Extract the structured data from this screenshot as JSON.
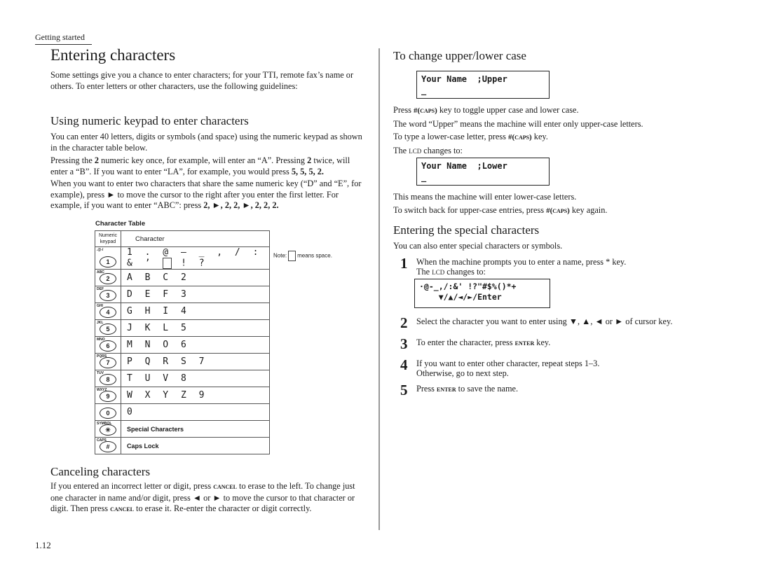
{
  "running_head": "Getting started",
  "page_title": "Entering characters",
  "intro": "Some settings give you a chance to enter characters; for your TTI, remote fax’s name or others. To enter letters or other characters, use the following guidelines:",
  "keypad_section": {
    "heading": "Using numeric keypad to enter characters",
    "p1": "You can enter 40 letters, digits or symbols (and space) using the numeric keypad as shown in the character table below.",
    "p2_a": "Pressing the ",
    "p2_b": "2",
    "p2_c": " numeric key once, for example, will enter an “A”. Pressing ",
    "p2_d": "2",
    "p2_e": " twice, will enter a “B”. If you want to enter “LA”, for example, you would press ",
    "p2_f": "5, 5, 5, 2.",
    "p3_a": "When you want to enter two characters that share the same numeric key (“D” and “E”, for example), press ► to move the cursor to the right after you enter the first letter. For example, if you want to enter “ABC”: press ",
    "p3_b": "2, ►, 2, 2, ►, 2, 2, 2."
  },
  "character_table": {
    "title": "Character Table",
    "header_key": "Numeric keypad",
    "header_chars": "Character",
    "note_prefix": "Note:",
    "note_suffix": "means space.",
    "rows": [
      {
        "key": "1",
        "sub": ".@-/",
        "chars_a": "1 . @ — _ , / : & ’",
        "chars_b": "! ?"
      },
      {
        "key": "2",
        "sub": "ABC",
        "chars": "A B C 2"
      },
      {
        "key": "3",
        "sub": "DEF",
        "chars": "D E F 3"
      },
      {
        "key": "4",
        "sub": "GHI",
        "chars": "G H I 4"
      },
      {
        "key": "5",
        "sub": "JKL",
        "chars": "J K L 5"
      },
      {
        "key": "6",
        "sub": "MNO",
        "chars": "M N O 6"
      },
      {
        "key": "7",
        "sub": "PQRS",
        "chars": "P Q R S 7"
      },
      {
        "key": "8",
        "sub": "TUV",
        "chars": "T U V 8"
      },
      {
        "key": "9",
        "sub": "WXYZ",
        "chars": "W X Y Z 9"
      },
      {
        "key": "0",
        "sub": "",
        "chars": "0"
      },
      {
        "key": "✳",
        "sub": "SYMBOL",
        "chars": "Special Characters"
      },
      {
        "key": "#",
        "sub": "CAPS",
        "chars": "Caps Lock"
      }
    ]
  },
  "cancel_section": {
    "heading": "Canceling characters",
    "a": "If you entered an incorrect letter or digit, press ",
    "cancel1": "cancel",
    "b": " to erase to the left. To change just one character in name and/or digit, press ◄ or ► to move the cursor to that character or digit. Then press ",
    "cancel2": "cancel",
    "c": " to erase it. Re-enter the character or digit correctly."
  },
  "case_section": {
    "heading": "To change upper/lower case",
    "lcd_upper_line1": "Your Name  ;Upper",
    "lcd_upper_line2": "_",
    "l1_a": "Press ",
    "l1_b": "#(caps)",
    "l1_c": " key to toggle upper case and lower case.",
    "l2": "The word “Upper” means the machine will enter only upper-case letters.",
    "l3_a": "To type a lower-case letter, press ",
    "l3_b": "#(caps)",
    "l3_c": " key.",
    "l4_a": "The ",
    "l4_b": "lcd",
    "l4_c": " changes to:",
    "lcd_lower_line1": "Your Name  ;Lower",
    "lcd_lower_line2": "_",
    "l5": "This means the machine will enter lower-case letters.",
    "l6_a": "To switch back for upper-case entries, press ",
    "l6_b": "#(caps)",
    "l6_c": " key again."
  },
  "special_section": {
    "heading": "Entering the special characters",
    "intro": "You can also enter special characters or symbols.",
    "lcd_line1": "·@-_,/:&' !?\"#$%()*+",
    "lcd_line2": "    ▼/▲/◄/►/Enter",
    "steps": [
      {
        "num": "1",
        "a": "When the machine prompts you to enter a name, press * key.",
        "b_pre": "The ",
        "b_sc": "lcd",
        "b_post": " changes to:"
      },
      {
        "num": "2",
        "text": "Select the character you want to enter using ▼, ▲, ◄ or ► of cursor key."
      },
      {
        "num": "3",
        "pre": "To enter the character, press ",
        "sc": "enter",
        "post": " key."
      },
      {
        "num": "4",
        "a": "If you want to enter other character, repeat steps 1–3.",
        "b": "Otherwise, go to next step."
      },
      {
        "num": "5",
        "pre": "Press ",
        "sc": "enter",
        "post": " to save the name."
      }
    ]
  },
  "page_number": "1.12"
}
